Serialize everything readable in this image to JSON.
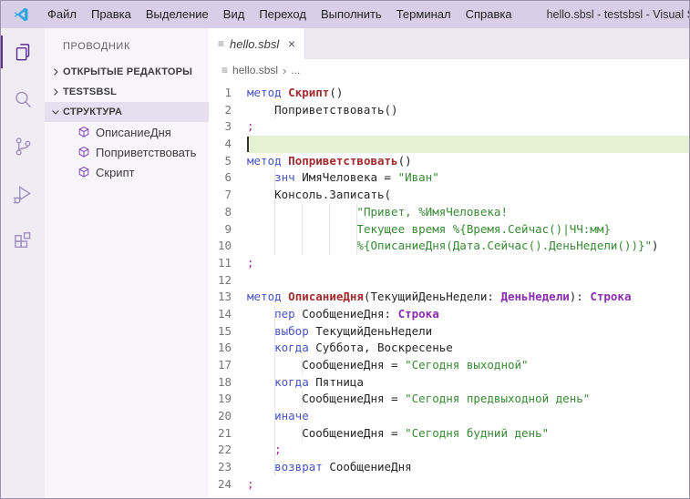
{
  "window": {
    "title": "hello.sbsl - testsbsl - Visual Studio Code"
  },
  "menubar": {
    "items": [
      "Файл",
      "Правка",
      "Выделение",
      "Вид",
      "Переход",
      "Выполнить",
      "Терминал",
      "Справка"
    ]
  },
  "activity_bar": {
    "items": [
      {
        "icon": "files-explorer-icon",
        "active": true
      },
      {
        "icon": "search-icon",
        "active": false
      },
      {
        "icon": "source-control-icon",
        "active": false
      },
      {
        "icon": "run-debug-icon",
        "active": false
      },
      {
        "icon": "extensions-icon",
        "active": false
      }
    ]
  },
  "sidebar": {
    "title": "ПРОВОДНИК",
    "sections": [
      {
        "label": "ОТКРЫТЫЕ РЕДАКТОРЫ",
        "expanded": false,
        "selected": false,
        "children": []
      },
      {
        "label": "TESTSBSL",
        "expanded": false,
        "selected": false,
        "children": []
      },
      {
        "label": "СТРУКТУРА",
        "expanded": true,
        "selected": true,
        "children": [
          "ОписаниеДня",
          "Поприветствовать",
          "Скрипт"
        ]
      }
    ]
  },
  "editor": {
    "tab": {
      "label": "hello.sbsl"
    },
    "breadcrumb": {
      "file": "hello.sbsl",
      "ellipsis": "..."
    }
  },
  "icons": {
    "file": "≡",
    "close": "×",
    "breadcrumb_separator": "›"
  },
  "code": {
    "language": "sbsl",
    "lines": [
      {
        "n": 1,
        "tokens": [
          [
            "kw",
            "метод"
          ],
          [
            "pn",
            " "
          ],
          [
            "fn",
            "Скрипт"
          ],
          [
            "pn",
            "()"
          ]
        ]
      },
      {
        "n": 2,
        "tokens": [
          [
            "pn",
            "    Поприветствовать()"
          ]
        ]
      },
      {
        "n": 3,
        "tokens": [
          [
            "sm",
            ";"
          ]
        ]
      },
      {
        "n": 4,
        "tokens": [],
        "hl": true,
        "cursor": true
      },
      {
        "n": 5,
        "tokens": [
          [
            "kw",
            "метод"
          ],
          [
            "pn",
            " "
          ],
          [
            "fn",
            "Поприветствовать"
          ],
          [
            "pn",
            "()"
          ]
        ]
      },
      {
        "n": 6,
        "tokens": [
          [
            "pn",
            "    "
          ],
          [
            "kw",
            "знч"
          ],
          [
            "pn",
            " ИмяЧеловека = "
          ],
          [
            "str",
            "\"Иван\""
          ]
        ]
      },
      {
        "n": 7,
        "tokens": [
          [
            "pn",
            "    Консоль.Записать("
          ]
        ]
      },
      {
        "n": 8,
        "tokens": [
          [
            "pn",
            "                "
          ],
          [
            "str",
            "\"Привет, %ИмяЧеловека!"
          ]
        ]
      },
      {
        "n": 9,
        "tokens": [
          [
            "pn",
            "                "
          ],
          [
            "str",
            "Текущее время %{Время.Сейчас()|ЧЧ:мм}"
          ]
        ]
      },
      {
        "n": 10,
        "tokens": [
          [
            "pn",
            "                "
          ],
          [
            "str",
            "%{ОписаниеДня(Дата.Сейчас().ДеньНедели())}\""
          ],
          [
            "pn",
            ")"
          ]
        ]
      },
      {
        "n": 11,
        "tokens": [
          [
            "sm",
            ";"
          ]
        ]
      },
      {
        "n": 12,
        "tokens": []
      },
      {
        "n": 13,
        "tokens": [
          [
            "kw",
            "метод"
          ],
          [
            "pn",
            " "
          ],
          [
            "fn",
            "ОписаниеДня"
          ],
          [
            "pn",
            "(ТекущийДеньНедели: "
          ],
          [
            "ty",
            "ДеньНедели"
          ],
          [
            "pn",
            "): "
          ],
          [
            "ty",
            "Строка"
          ]
        ]
      },
      {
        "n": 14,
        "tokens": [
          [
            "pn",
            "    "
          ],
          [
            "kw",
            "пер"
          ],
          [
            "pn",
            " СообщениеДня: "
          ],
          [
            "ty",
            "Строка"
          ]
        ]
      },
      {
        "n": 15,
        "tokens": [
          [
            "pn",
            "    "
          ],
          [
            "kw",
            "выбор"
          ],
          [
            "pn",
            " ТекущийДеньНедели"
          ]
        ]
      },
      {
        "n": 16,
        "tokens": [
          [
            "pn",
            "    "
          ],
          [
            "kw",
            "когда"
          ],
          [
            "pn",
            " Суббота, Воскресенье"
          ]
        ]
      },
      {
        "n": 17,
        "tokens": [
          [
            "pn",
            "        СообщениеДня = "
          ],
          [
            "str",
            "\"Сегодня выходной\""
          ]
        ]
      },
      {
        "n": 18,
        "tokens": [
          [
            "pn",
            "    "
          ],
          [
            "kw",
            "когда"
          ],
          [
            "pn",
            " Пятница"
          ]
        ]
      },
      {
        "n": 19,
        "tokens": [
          [
            "pn",
            "        СообщениеДня = "
          ],
          [
            "str",
            "\"Сегодня предвыходной день\""
          ]
        ]
      },
      {
        "n": 20,
        "tokens": [
          [
            "pn",
            "    "
          ],
          [
            "kw",
            "иначе"
          ]
        ]
      },
      {
        "n": 21,
        "tokens": [
          [
            "pn",
            "        СообщениеДня = "
          ],
          [
            "str",
            "\"Сегодня будний день\""
          ]
        ]
      },
      {
        "n": 22,
        "tokens": [
          [
            "pn",
            "    "
          ],
          [
            "sm",
            ";"
          ]
        ]
      },
      {
        "n": 23,
        "tokens": [
          [
            "pn",
            "    "
          ],
          [
            "kw",
            "возврат"
          ],
          [
            "pn",
            " СообщениеДня"
          ]
        ]
      },
      {
        "n": 24,
        "tokens": [
          [
            "sm",
            ";"
          ]
        ]
      }
    ]
  },
  "colors": {
    "titlebar_bg": "#d9cee8",
    "activitybar_bg": "#efecf4",
    "sidebar_bg": "#f7f5fa",
    "sidebar_selection_bg": "#e6dff0",
    "tabbar_bg": "#ece8f1",
    "editor_bg": "#ffffff",
    "current_line_bg": "#e5f1d3",
    "accent_purple": "#5c2d91",
    "logo_blue": "#29a8e0",
    "keyword": "#4752c4",
    "method_name": "#a02c2e",
    "type_name": "#8a2eae",
    "string": "#388a34",
    "semicolon": "#a626a4"
  }
}
